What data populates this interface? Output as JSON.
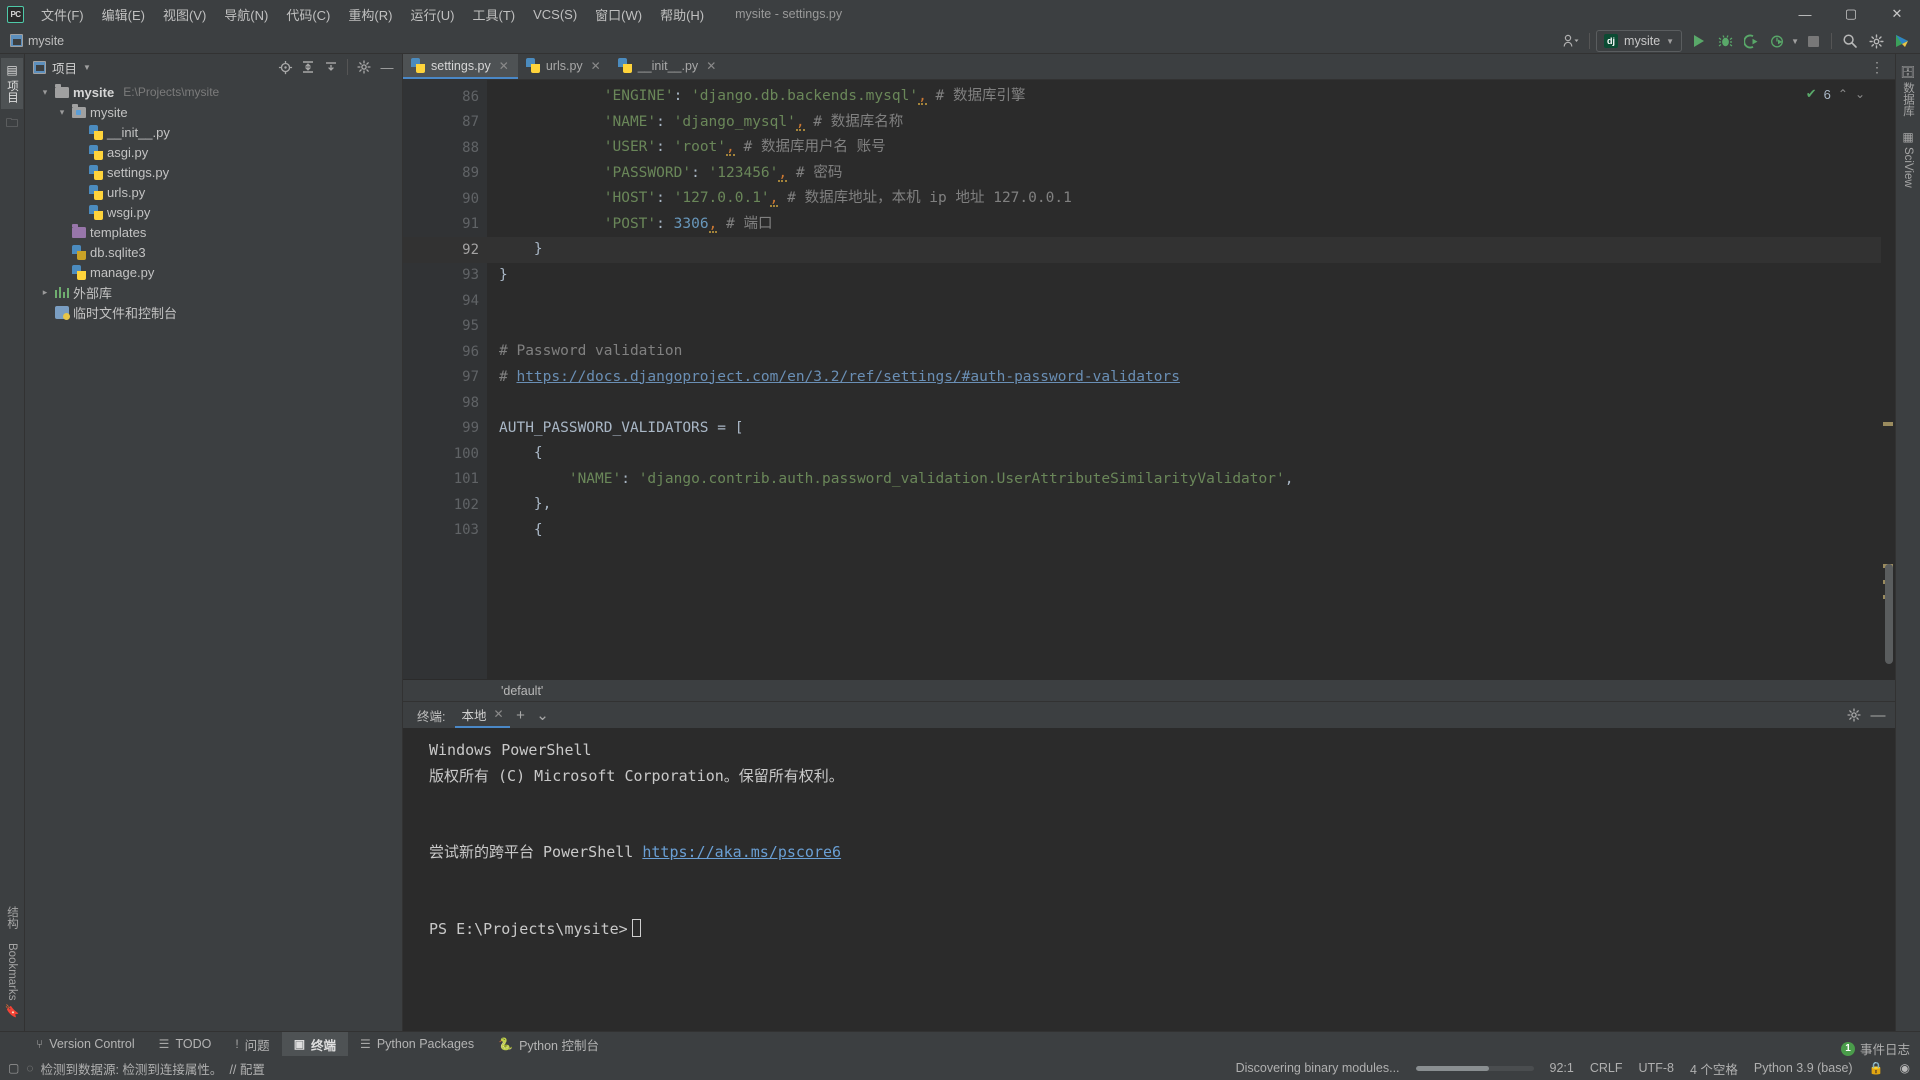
{
  "titlebar": {
    "logo": "PC",
    "menus": [
      "文件(F)",
      "编辑(E)",
      "视图(V)",
      "导航(N)",
      "代码(C)",
      "重构(R)",
      "运行(U)",
      "工具(T)",
      "VCS(S)",
      "窗口(W)",
      "帮助(H)"
    ],
    "window_title": "mysite - settings.py",
    "minimize": "—",
    "maximize": "▢",
    "close": "✕"
  },
  "navbar": {
    "breadcrumb": "mysite",
    "run_config": "mysite",
    "django_badge": "dj"
  },
  "left_strip": {
    "project_tab": "项目",
    "structure_tab": "结构",
    "bookmarks_tab": "Bookmarks"
  },
  "right_strip": {
    "database_tab": "数据库",
    "sciview_tab": "SciView"
  },
  "project": {
    "title": "项目",
    "tree": [
      {
        "indent": 0,
        "twist": "⌄",
        "icon": "folder",
        "label": "mysite",
        "bold": true,
        "path": "E:\\Projects\\mysite"
      },
      {
        "indent": 1,
        "twist": "⌄",
        "icon": "folder-src",
        "label": "mysite",
        "bold": false,
        "path": ""
      },
      {
        "indent": 2,
        "twist": "",
        "icon": "python",
        "label": "__init__.py",
        "bold": false,
        "path": ""
      },
      {
        "indent": 2,
        "twist": "",
        "icon": "python",
        "label": "asgi.py",
        "bold": false,
        "path": ""
      },
      {
        "indent": 2,
        "twist": "",
        "icon": "python",
        "label": "settings.py",
        "bold": false,
        "path": ""
      },
      {
        "indent": 2,
        "twist": "",
        "icon": "python",
        "label": "urls.py",
        "bold": false,
        "path": ""
      },
      {
        "indent": 2,
        "twist": "",
        "icon": "python",
        "label": "wsgi.py",
        "bold": false,
        "path": ""
      },
      {
        "indent": 1,
        "twist": "",
        "icon": "folder-purple",
        "label": "templates",
        "bold": false,
        "path": ""
      },
      {
        "indent": 1,
        "twist": "",
        "icon": "python-q",
        "label": "db.sqlite3",
        "bold": false,
        "path": ""
      },
      {
        "indent": 1,
        "twist": "",
        "icon": "python",
        "label": "manage.py",
        "bold": false,
        "path": ""
      },
      {
        "indent": 0,
        "twist": "›",
        "icon": "lib",
        "label": "外部库",
        "bold": false,
        "path": ""
      },
      {
        "indent": 0,
        "twist": "",
        "icon": "scratch",
        "label": "临时文件和控制台",
        "bold": false,
        "path": ""
      }
    ]
  },
  "editor": {
    "tabs": [
      {
        "label": "settings.py",
        "active": true
      },
      {
        "label": "urls.py",
        "active": false
      },
      {
        "label": "__init__.py",
        "active": false
      }
    ],
    "inspection_count": "6",
    "sticky_breadcrumb": "'default'",
    "lines": [
      {
        "num": "86",
        "fold": "",
        "cur": false,
        "tokens": [
          {
            "t": "            ",
            "c": "k-id"
          },
          {
            "t": "'ENGINE'",
            "c": "k-str"
          },
          {
            "t": ": ",
            "c": "k-id"
          },
          {
            "t": "'django.db.backends.mysql'",
            "c": "k-str"
          },
          {
            "t": ",",
            "c": "comma"
          },
          {
            "t": " # 数据库引擎",
            "c": "k-cmt"
          }
        ]
      },
      {
        "num": "87",
        "fold": "",
        "cur": false,
        "tokens": [
          {
            "t": "            ",
            "c": "k-id"
          },
          {
            "t": "'NAME'",
            "c": "k-str"
          },
          {
            "t": ": ",
            "c": "k-id"
          },
          {
            "t": "'django_mysql'",
            "c": "k-str"
          },
          {
            "t": ",",
            "c": "comma"
          },
          {
            "t": " # 数据库名称",
            "c": "k-cmt"
          }
        ]
      },
      {
        "num": "88",
        "fold": "",
        "cur": false,
        "tokens": [
          {
            "t": "            ",
            "c": "k-id"
          },
          {
            "t": "'USER'",
            "c": "k-str"
          },
          {
            "t": ": ",
            "c": "k-id"
          },
          {
            "t": "'root'",
            "c": "k-str"
          },
          {
            "t": ",",
            "c": "comma"
          },
          {
            "t": " # 数据库用户名 账号",
            "c": "k-cmt"
          }
        ]
      },
      {
        "num": "89",
        "fold": "",
        "cur": false,
        "tokens": [
          {
            "t": "            ",
            "c": "k-id"
          },
          {
            "t": "'PASSWORD'",
            "c": "k-str"
          },
          {
            "t": ": ",
            "c": "k-id"
          },
          {
            "t": "'123456'",
            "c": "k-str"
          },
          {
            "t": ",",
            "c": "comma"
          },
          {
            "t": " # 密码",
            "c": "k-cmt"
          }
        ]
      },
      {
        "num": "90",
        "fold": "",
        "cur": false,
        "tokens": [
          {
            "t": "            ",
            "c": "k-id"
          },
          {
            "t": "'HOST'",
            "c": "k-str"
          },
          {
            "t": ": ",
            "c": "k-id"
          },
          {
            "t": "'127.0.0.1'",
            "c": "k-str"
          },
          {
            "t": ",",
            "c": "comma"
          },
          {
            "t": " # 数据库地址，本机 ip 地址 127.0.0.1",
            "c": "k-cmt"
          }
        ]
      },
      {
        "num": "91",
        "fold": "",
        "cur": false,
        "tokens": [
          {
            "t": "            ",
            "c": "k-id"
          },
          {
            "t": "'POST'",
            "c": "k-str"
          },
          {
            "t": ": ",
            "c": "k-id"
          },
          {
            "t": "3306",
            "c": "k-num"
          },
          {
            "t": ",",
            "c": "comma"
          },
          {
            "t": " # 端口",
            "c": "k-cmt"
          }
        ]
      },
      {
        "num": "92",
        "fold": "⌂",
        "cur": true,
        "tokens": [
          {
            "t": "    }",
            "c": "k-id"
          }
        ]
      },
      {
        "num": "93",
        "fold": "⊟",
        "cur": false,
        "tokens": [
          {
            "t": "}",
            "c": "k-id"
          }
        ]
      },
      {
        "num": "94",
        "fold": "",
        "cur": false,
        "tokens": []
      },
      {
        "num": "95",
        "fold": "",
        "cur": false,
        "tokens": []
      },
      {
        "num": "96",
        "fold": "⊟",
        "cur": false,
        "tokens": [
          {
            "t": "# Password validation",
            "c": "k-cmt"
          }
        ]
      },
      {
        "num": "97",
        "fold": "⊟",
        "cur": false,
        "tokens": [
          {
            "t": "# ",
            "c": "k-cmt"
          },
          {
            "t": "https://docs.djangoproject.com/en/3.2/ref/settings/#auth-password-validators",
            "c": "k-lnk"
          }
        ]
      },
      {
        "num": "98",
        "fold": "",
        "cur": false,
        "tokens": []
      },
      {
        "num": "99",
        "fold": "⊟",
        "cur": false,
        "tokens": [
          {
            "t": "AUTH_PASSWORD_VALIDATORS = [",
            "c": "k-id"
          }
        ]
      },
      {
        "num": "100",
        "fold": "⊟",
        "cur": false,
        "tokens": [
          {
            "t": "    {",
            "c": "k-id"
          }
        ]
      },
      {
        "num": "101",
        "fold": "",
        "cur": false,
        "tokens": [
          {
            "t": "        ",
            "c": "k-id"
          },
          {
            "t": "'NAME'",
            "c": "k-str"
          },
          {
            "t": ": ",
            "c": "k-id"
          },
          {
            "t": "'django.contrib.auth.password_validation.UserAttributeSimilarityValidator'",
            "c": "k-str"
          },
          {
            "t": ",",
            "c": "k-id"
          }
        ]
      },
      {
        "num": "102",
        "fold": "⌂",
        "cur": false,
        "tokens": [
          {
            "t": "    },",
            "c": "k-id"
          }
        ]
      },
      {
        "num": "103",
        "fold": "",
        "cur": false,
        "tokens": [
          {
            "t": "    {",
            "c": "k-id"
          }
        ]
      }
    ]
  },
  "terminal": {
    "label": "终端:",
    "tab": "本地",
    "add": "+",
    "dropdown": "⌄",
    "lines": [
      {
        "type": "text",
        "text": "Windows PowerShell"
      },
      {
        "type": "text",
        "text": "版权所有 (C) Microsoft Corporation。保留所有权利。"
      },
      {
        "type": "blank",
        "text": ""
      },
      {
        "type": "blank",
        "text": ""
      },
      {
        "type": "link",
        "text": "尝试新的跨平台 PowerShell ",
        "link": "https://aka.ms/pscore6"
      },
      {
        "type": "blank",
        "text": ""
      },
      {
        "type": "blank",
        "text": ""
      },
      {
        "type": "prompt",
        "text": "PS E:\\Projects\\mysite>"
      }
    ]
  },
  "toolwindow_bar": [
    {
      "icon": "branch-icon",
      "label": "Version Control",
      "active": false
    },
    {
      "icon": "list-icon",
      "label": "TODO",
      "active": false
    },
    {
      "icon": "warning-icon",
      "label": "问题",
      "active": false
    },
    {
      "icon": "terminal-icon",
      "label": "终端",
      "active": true
    },
    {
      "icon": "packages-icon",
      "label": "Python Packages",
      "active": false
    },
    {
      "icon": "python-icon",
      "label": "Python 控制台",
      "active": false
    }
  ],
  "statusbar": {
    "message": "检测到数据源: 检测到连接属性。",
    "config_link": "// 配置",
    "progress_text": "Discovering binary modules...",
    "caret": "92:1",
    "line_sep": "CRLF",
    "encoding": "UTF-8",
    "indent": "4 个空格",
    "interpreter": "Python 3.9 (base)",
    "event_log": "事件日志",
    "event_count": "1"
  },
  "colors": {
    "accent": "#4a88c7",
    "green": "#59a869",
    "bg_panel": "#3c3f41",
    "bg_editor": "#2b2b2b",
    "string": "#6a8759",
    "comment": "#808080",
    "number": "#6897bb"
  }
}
